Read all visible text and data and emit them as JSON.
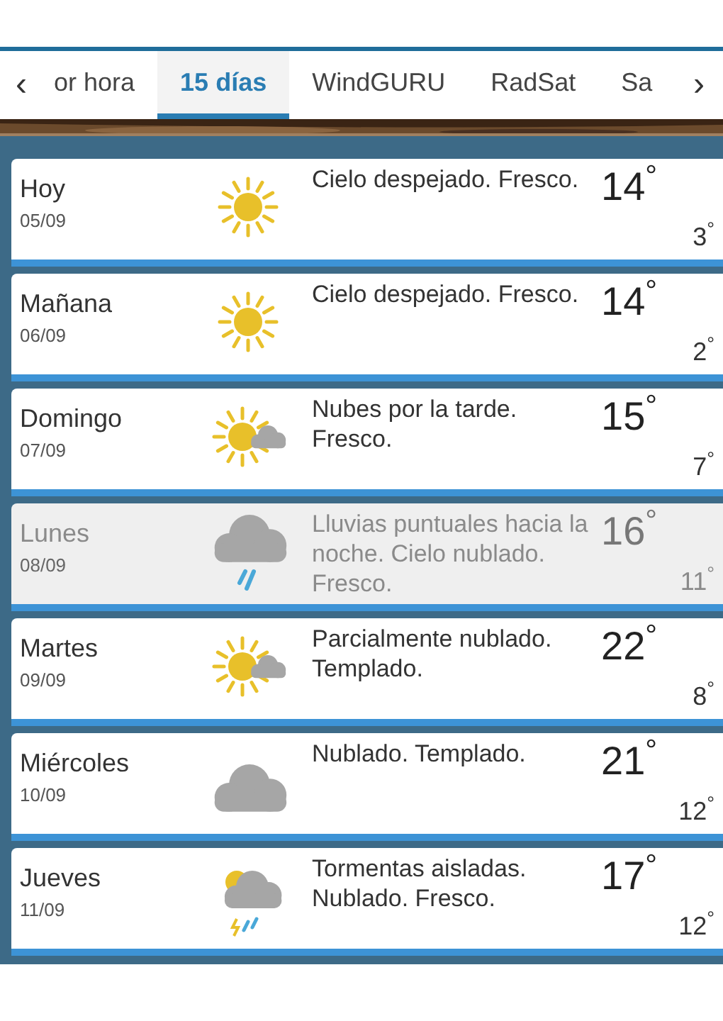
{
  "tabs": {
    "prev": "‹",
    "next": "›",
    "items": [
      {
        "label": "or hora",
        "selected": false
      },
      {
        "label": "15 días",
        "selected": true
      },
      {
        "label": "WindGURU",
        "selected": false
      },
      {
        "label": "RadSat",
        "selected": false
      },
      {
        "label": "Sa",
        "selected": false
      }
    ]
  },
  "days": [
    {
      "day": "Hoy",
      "date": "05/09",
      "kind": "sun",
      "summary": "Cielo despejado. Fresco.",
      "max": "14$^{°}$",
      "min": "3$^{°}$",
      "dimmed": false
    },
    {
      "day": "Mañana",
      "date": "06/09",
      "kind": "sun",
      "summary": "Cielo despejado. Fresco.",
      "max": "14$^{°}$",
      "min": "2$^{°}$",
      "dimmed": false
    },
    {
      "day": "Domingo",
      "date": "07/09",
      "kind": "sun_cloud",
      "summary": "Nubes por la tarde. Fresco.",
      "max": "15$^{°}$",
      "min": "7$^{°}$",
      "dimmed": false
    },
    {
      "day": "Lunes",
      "date": "08/09",
      "kind": "rain",
      "summary": "Lluvias puntuales hacia la noche. Cielo nublado. Fresco.",
      "max": "16$^{°}$",
      "min": "11$^{°}$",
      "dimmed": true
    },
    {
      "day": "Martes",
      "date": "09/09",
      "kind": "sun_cloud",
      "summary": "Parcialmente nublado. Templado.",
      "max": "22$^{°}$",
      "min": "8$^{°}$",
      "dimmed": false
    },
    {
      "day": "Miércoles",
      "date": "10/09",
      "kind": "cloud",
      "summary": "Nublado. Templado.",
      "max": "21$^{°}$",
      "min": "12$^{°}$",
      "dimmed": false
    },
    {
      "day": "Jueves",
      "date": "11/09",
      "kind": "storm",
      "summary": "Tormentas aisladas. Nublado. Fresco.",
      "max": "17$^{°}$",
      "min": "12$^{°}$",
      "dimmed": false
    }
  ]
}
